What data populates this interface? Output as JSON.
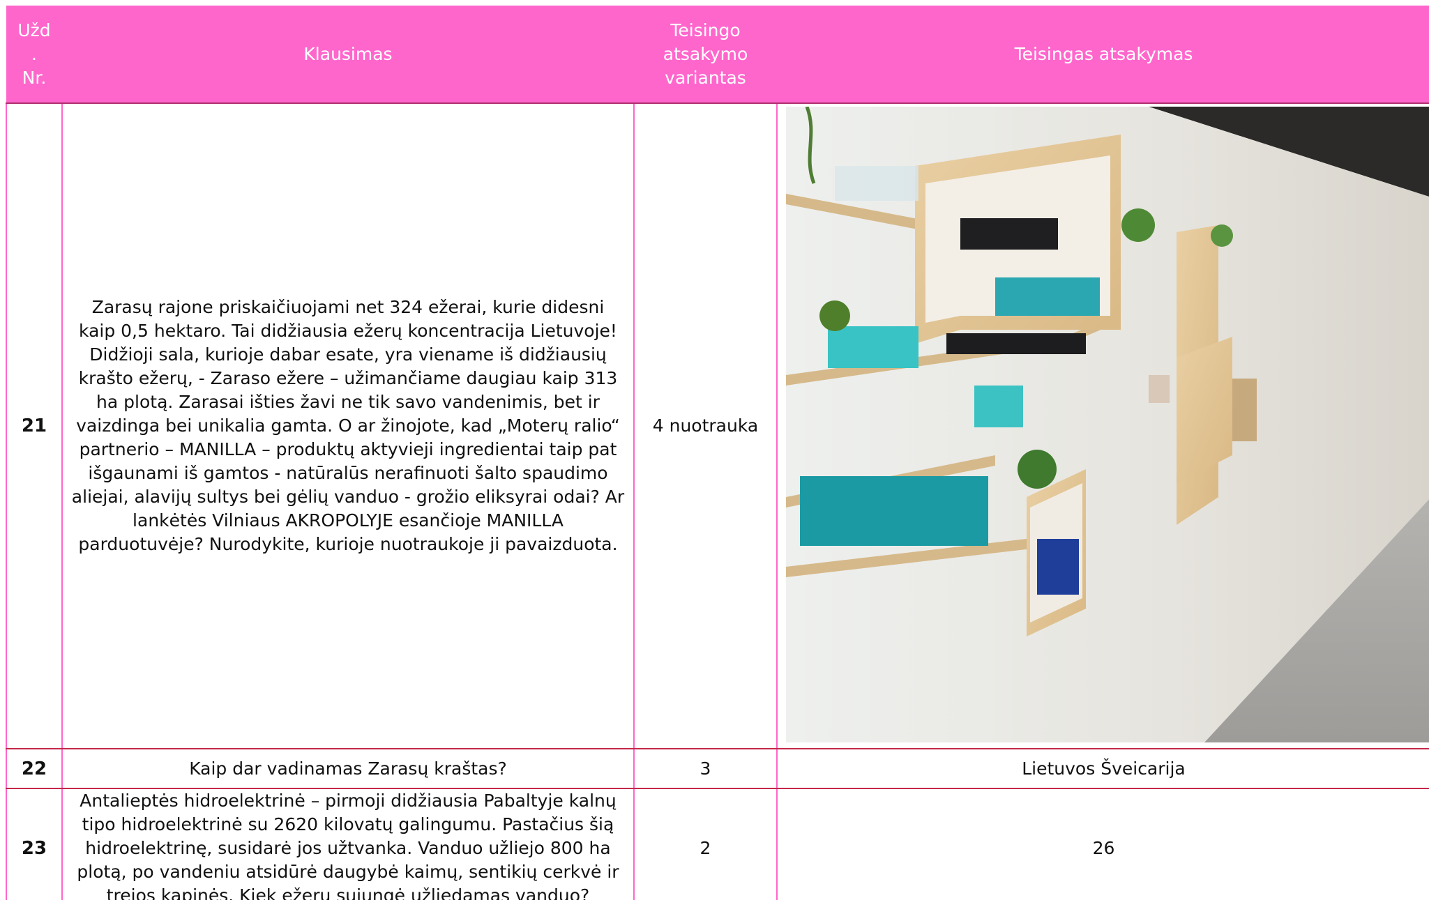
{
  "table": {
    "headers": {
      "task_no": "Užd\n.\nNr.",
      "question": "Klausimas",
      "correct_option": "Teisingo\natsakymo\nvariantas",
      "correct_answer": "Teisingas atsakymas"
    },
    "rows": [
      {
        "no": "21",
        "question": "Zarasų rajone priskaičiuojami net 324 ežerai, kurie didesni kaip 0,5 hektaro. Tai didžiausia ežerų koncentracija Lietuvoje! Didžioji sala, kurioje dabar esate, yra viename iš didžiausių krašto ežerų, - Zaraso ežere – užimančiame daugiau kaip 313 ha plotą. Zarasai išties žavi ne tik savo vandenimis, bet ir vaizdinga bei unikalia gamta. O ar žinojote, kad „Moterų ralio“ partnerio – MANILLA – produktų aktyvieji ingredientai taip pat išgaunami iš gamtos - natūralūs nerafinuoti šalto spaudimo aliejai, alavijų sultys bei gėlių vanduo - grožio eliksyrai odai? Ar lankėtės Vilniaus AKROPOLYJE esančioje MANILLA parduotuvėje? Nurodykite, kurioje nuotraukoje ji pavaizduota.",
        "option": "4 nuotrauka",
        "answer_image": "photo-manilla-store-shelves"
      },
      {
        "no": "22",
        "question": "Kaip dar vadinamas Zarasų kraštas?",
        "option": "3",
        "answer": "Lietuvos Šveicarija"
      },
      {
        "no": "23",
        "question": "Antalieptės hidroelektrinė – pirmoji didžiausia Pabaltyje kalnų tipo hidroelektrinė su 2620 kilovatų galingumu. Pastačius šią hidroelektrinę, susidarė jos užtvanka. Vanduo užliejo 800 ha plotą, po vandeniu atsidūrė daugybė kaimų, sentikių cerkvė ir trejos kapinės. Kiek ežerų sujungė užliedamas vanduo?",
        "option": "2",
        "answer": "26"
      }
    ]
  },
  "colors": {
    "header_bg": "#ff66cc",
    "header_text": "#ffffff",
    "grid_vertical": "#ff66cc",
    "grid_horizontal": "#c5284a"
  }
}
